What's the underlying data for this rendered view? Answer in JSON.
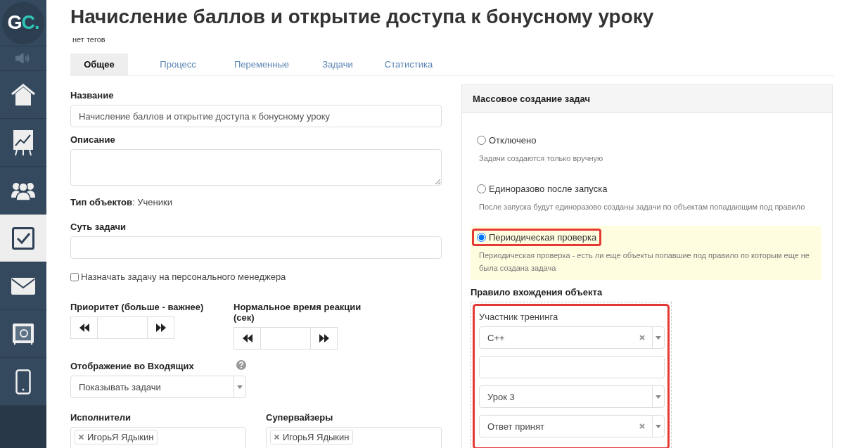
{
  "sidebar": {
    "logo": "GC.",
    "items": [
      {
        "kind": "sound",
        "selected": false
      },
      {
        "kind": "home",
        "selected": false
      },
      {
        "kind": "chart",
        "selected": false
      },
      {
        "kind": "users",
        "selected": false
      },
      {
        "kind": "tasks",
        "selected": true
      },
      {
        "kind": "mail",
        "selected": false
      },
      {
        "kind": "safe",
        "selected": false
      },
      {
        "kind": "phone",
        "selected": false
      }
    ]
  },
  "title": "Начисление баллов и открытие доступа к бонусному уроку",
  "tags": "нет тегов",
  "tabs": [
    {
      "label": "Общее",
      "selected": true
    },
    {
      "label": "Процесс",
      "selected": false
    },
    {
      "label": "Переменные",
      "selected": false
    },
    {
      "label": "Задачи",
      "selected": false
    },
    {
      "label": "Статистика",
      "selected": false
    }
  ],
  "form": {
    "name": {
      "label": "Название",
      "value": "Начисление баллов и открытие доступа к бонусному уроку"
    },
    "description": {
      "label": "Описание"
    },
    "object_type": {
      "text": "**Тип объектов**: Ученики"
    },
    "essence": {
      "label": "Суть задачи"
    },
    "personal_manager": {
      "label": "Назначать задачу на персонального менеджера",
      "checked": false
    },
    "priority": {
      "label": "Приоритет (больше - важнее)"
    },
    "reaction_time": {
      "label": "Нормальное время реакции (сек)"
    },
    "inbox_display": {
      "label": "Отображение во Входящих",
      "value": "Показывать задачи"
    },
    "executors": {
      "label": "Исполнители",
      "tags": [
        "ИгорьЯ Ядыкин"
      ]
    },
    "supervisors": {
      "label": "Супервайзеры",
      "tags": [
        "ИгорьЯ Ядыкин"
      ]
    }
  },
  "mass_creation": {
    "title": "Массовое создание задач",
    "options": [
      {
        "label": "Отключено",
        "description": "Задачи создаются только вручную",
        "selected": false,
        "highlighted": false
      },
      {
        "label": "Единоразово после запуска",
        "description": "После запуска будут единоразово созданы задачи по объектам попадающим под правило",
        "selected": false,
        "highlighted": false
      },
      {
        "label": "Периодическая проверка",
        "description": "Периодическая проверка - есть ли еще объекты попавшие под правило по которым еще не была создана задача",
        "selected": true,
        "highlighted": true
      }
    ],
    "rule": {
      "title": "Правило вхождения объекта",
      "highlighted": true,
      "label": "Участник тренинга",
      "filters": [
        {
          "kind": "select",
          "value": "C++",
          "clearable": true
        },
        {
          "kind": "input"
        },
        {
          "kind": "select",
          "value": "Урок 3",
          "clearable": false
        },
        {
          "kind": "select",
          "value": "Ответ принят",
          "clearable": true
        }
      ]
    }
  }
}
